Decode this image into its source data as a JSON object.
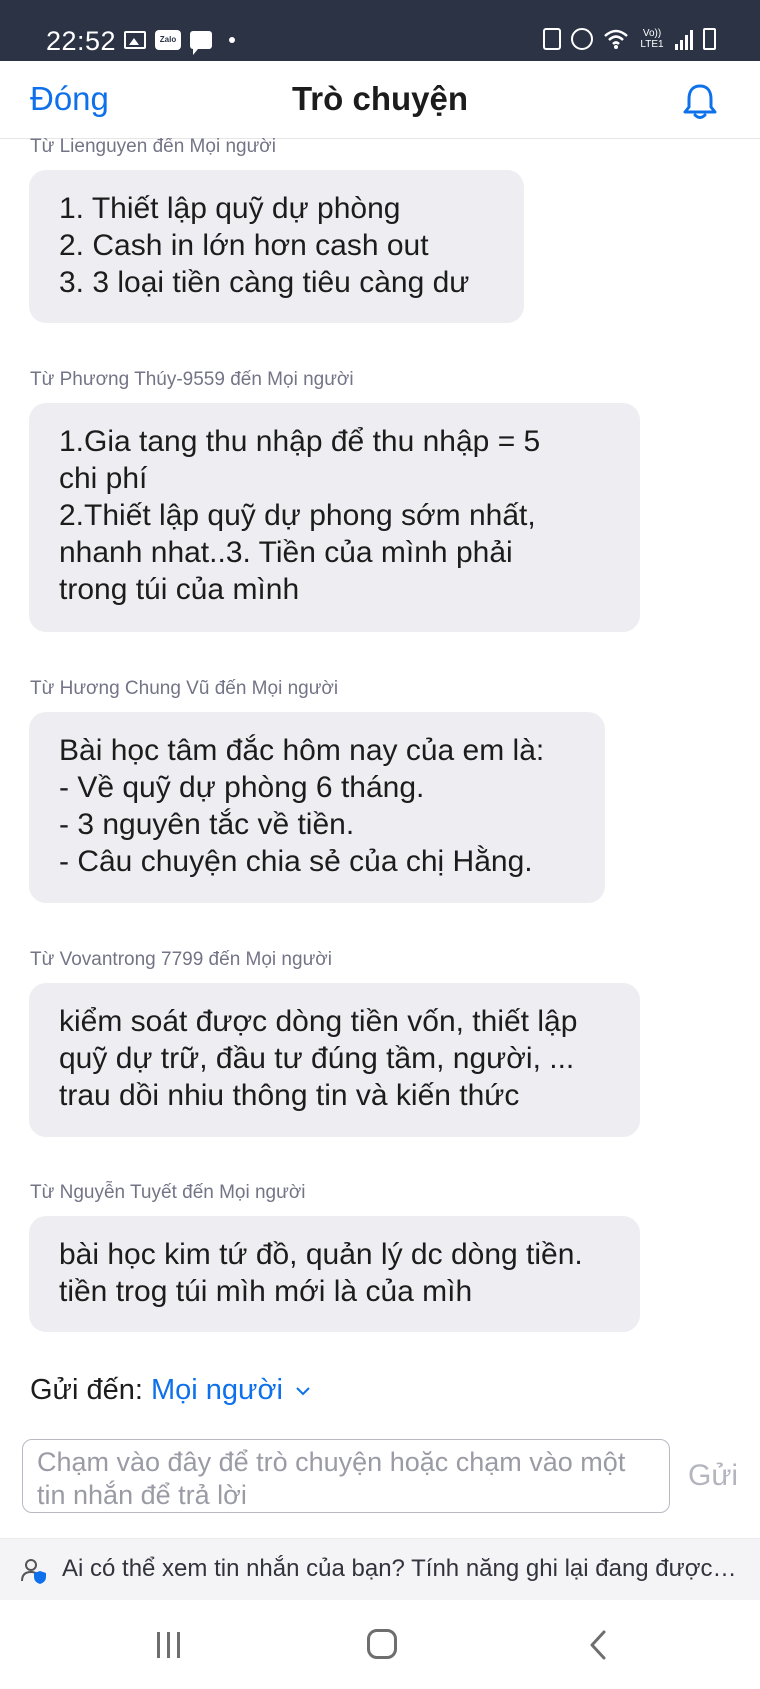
{
  "status_bar": {
    "time": "22:52",
    "left_icons": [
      "gallery-icon",
      "zalo-icon",
      "message-icon",
      "dot-icon"
    ],
    "zalo_label": "Zalo",
    "network_label": "Vo)) LTE1",
    "right_icons": [
      "lock-icon",
      "alarm-icon",
      "wifi-icon",
      "signal-icon",
      "battery-icon"
    ]
  },
  "header": {
    "close_label": "Đóng",
    "title": "Trò chuyện",
    "bell_icon": "bell-icon"
  },
  "messages": [
    {
      "sender": "Từ Lienguyen đến Mọi người",
      "text": "1. Thiết lập quỹ dự phòng\n2. Cash in lớn hơn cash out\n3. 3 loại tiền càng tiêu càng dư"
    },
    {
      "sender": "Từ Phương Thúy-9559 đến Mọi người",
      "text": "1.Gia tang thu nhập để thu nhập = 5\nchi phí\n2.Thiết lập quỹ dự phong sớm nhất,\nnhanh nhat..3. Tiền của mình phải\ntrong túi của mình"
    },
    {
      "sender": "Từ Hương Chung Vũ đến Mọi người",
      "text": "Bài học tâm đắc hôm nay của em là:\n- Về quỹ dự phòng 6 tháng.\n- 3 nguyên tắc về tiền.\n- Câu chuyện chia sẻ của chị Hằng."
    },
    {
      "sender": "Từ Vovantrong 7799 đến Mọi người",
      "text": "kiểm soát được dòng tiền vốn, thiết lập\nquỹ dự trữ, đầu tư đúng tầm, người, ...\ntrau dồi nhiu thông tin và kiến thức"
    },
    {
      "sender": "Từ Nguyễn Tuyết đến Mọi người",
      "text": "bài học kim tứ đồ, quản lý dc dòng tiền.\ntiền trog túi mìh mới là của mìh"
    }
  ],
  "composer": {
    "send_to_label": "Gửi đến:",
    "recipient": "Mọi người",
    "placeholder": "Chạm vào đây để trò chuyện hoặc chạm vào một tin nhắn để trả lời",
    "send_label": "Gửi"
  },
  "privacy_notice": {
    "icon": "user-privacy-icon",
    "text": "Ai có thể xem tin nhắn của bạn? Tính năng ghi lại đang được…"
  },
  "nav_bar": {
    "icons": [
      "recent-apps-icon",
      "home-icon",
      "back-icon"
    ]
  },
  "colors": {
    "status_bar_bg": "#2c3345",
    "accent": "#0e71eb",
    "bubble_bg": "#eeeef2",
    "sender_text": "#747487"
  }
}
